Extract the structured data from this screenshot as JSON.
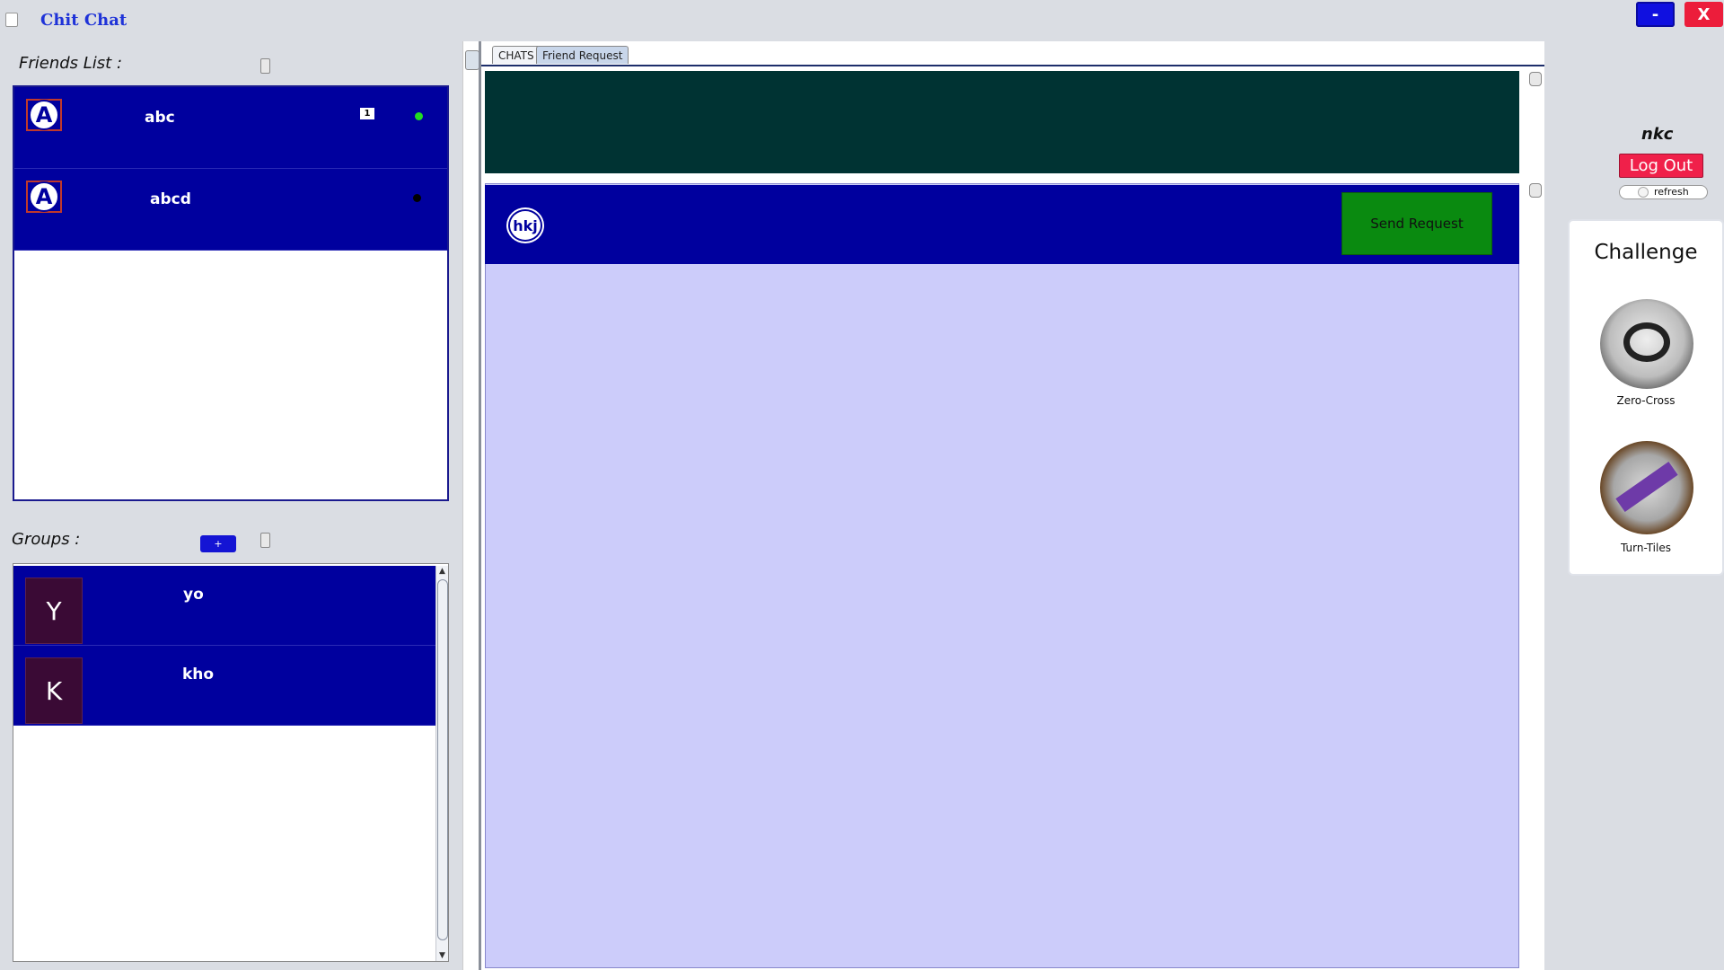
{
  "window": {
    "title": "Chit Chat",
    "minimize_label": "-",
    "close_label": "X"
  },
  "friends": {
    "label": "Friends List :",
    "items": [
      {
        "initial": "A",
        "name": "abc",
        "unread": "1",
        "status_color": "#22dd22"
      },
      {
        "initial": "A",
        "name": "abcd",
        "unread": "",
        "status_color": "#000000"
      }
    ]
  },
  "groups": {
    "label": "Groups :",
    "add_label": "+",
    "items": [
      {
        "initial": "Y",
        "name": "yo"
      },
      {
        "initial": "K",
        "name": "kho"
      }
    ]
  },
  "tabs": [
    {
      "label": "CHATS",
      "active": false
    },
    {
      "label": "Friend Request",
      "active": true
    }
  ],
  "friend_request": {
    "requester": "hkj",
    "send_label": "Send Request"
  },
  "user": {
    "name": "nkc",
    "logout_label": "Log Out",
    "refresh_label": "refresh"
  },
  "challenge": {
    "title": "Challenge",
    "games": [
      {
        "name": "Zero-Cross",
        "icon": "zero-cross-game-icon"
      },
      {
        "name": "Turn-Tiles",
        "icon": "turn-tiles-game-icon"
      }
    ]
  },
  "colors": {
    "accent_blue": "#00009e",
    "logout_red": "#f0204a",
    "send_green": "#0a8a10",
    "dark_panel": "#003333",
    "request_bg": "#ccccfa"
  }
}
